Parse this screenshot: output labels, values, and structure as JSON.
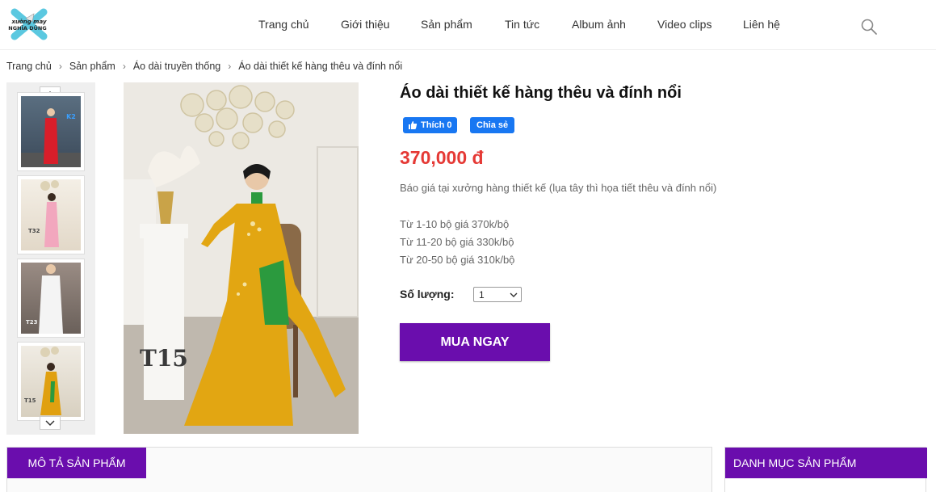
{
  "header": {
    "nav": [
      "Trang chủ",
      "Giới thiệu",
      "Sản phẩm",
      "Tin tức",
      "Album ảnh",
      "Video clips",
      "Liên hệ"
    ],
    "logo_text": "xưởng may nghĩa dũng"
  },
  "breadcrumb": [
    "Trang chủ",
    "Sản phẩm",
    "Áo dài truyền thống",
    "Áo dài thiết kế hàng thêu và đính nổi"
  ],
  "product": {
    "title": "Áo dài thiết kế hàng thêu và đính nổi",
    "like_label": "Thích 0",
    "share_label": "Chia sẻ",
    "price": "370,000 đ",
    "description": "Báo giá tại xưởng hàng thiết kế (lụa tây thì họa tiết thêu và đính nổi)",
    "tiers": [
      "Từ 1-10 bộ giá 370k/bộ",
      "Từ 11-20 bộ giá 330k/bộ",
      "Từ 20-50 bộ giá 310k/bộ"
    ],
    "quantity_label": "Số lượng:",
    "quantity_value": "1",
    "buy_label": "MUA NGAY",
    "main_image_tag": "T15"
  },
  "thumbnails": [
    {
      "tag": "K2",
      "dress_color": "#d81e2a"
    },
    {
      "tag": "T32",
      "dress_color": "#f2a7be"
    },
    {
      "tag": "T23",
      "dress_color": "#f4f4f4"
    },
    {
      "tag": "T15",
      "dress_color": "#e0a010"
    }
  ],
  "sections": {
    "description_tab": "MÔ TẢ SẢN PHẨM",
    "category_heading": "DANH MỤC SẢN PHẨM"
  },
  "colors": {
    "accent": "#6a0dad",
    "price": "#e53935",
    "facebook": "#1877f2"
  }
}
